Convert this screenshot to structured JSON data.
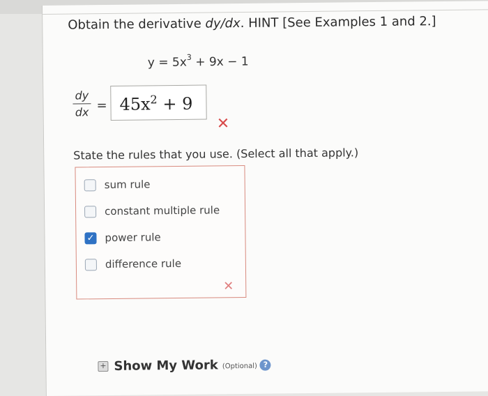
{
  "question": {
    "prefix": "Obtain the derivative ",
    "derivative": "dy/dx",
    "suffix": ". HINT [See Examples 1 and 2.]"
  },
  "equation": {
    "lhs": "y = 5x",
    "exp": "3",
    "rhs": " + 9x − 1"
  },
  "answer": {
    "num": "dy",
    "den": "dx",
    "equals": "=",
    "value_coef": "45x",
    "value_exp": "2",
    "value_rest": " + 9",
    "status_icon": "x-mark-icon",
    "status_color": "#d84a4a"
  },
  "rules": {
    "prompt": "State the rules that you use. (Select all that apply.)",
    "options": [
      {
        "label": "sum rule",
        "checked": false
      },
      {
        "label": "constant multiple rule",
        "checked": false
      },
      {
        "label": "power rule",
        "checked": true
      },
      {
        "label": "difference rule",
        "checked": false
      }
    ],
    "status_icon": "x-mark-icon"
  },
  "show_work": {
    "label": "Show My Work",
    "optional": "(Optional)",
    "help": "?"
  },
  "colors": {
    "checkbox_checked": "#2f72c4",
    "error": "#d84a4a"
  }
}
